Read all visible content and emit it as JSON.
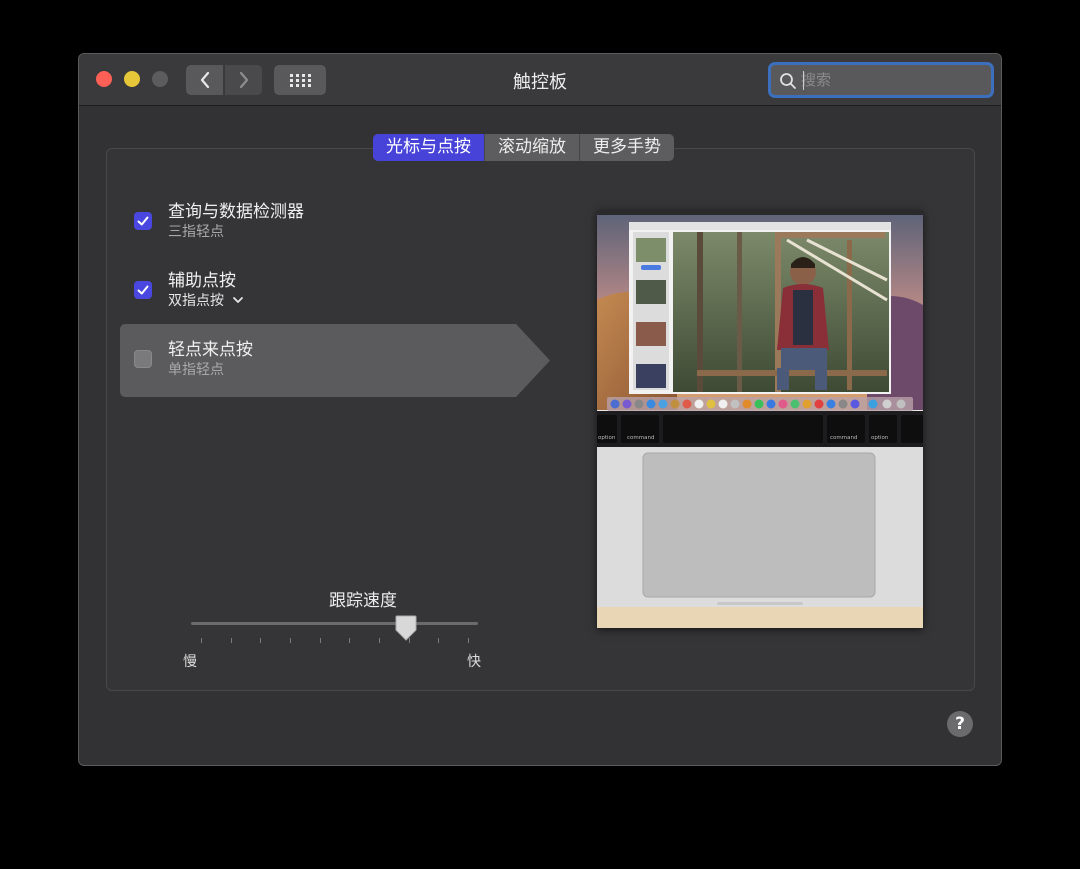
{
  "window": {
    "title": "触控板"
  },
  "toolbar": {
    "back_icon": "chevron-left-icon",
    "forward_icon": "chevron-right-icon",
    "grid_icon": "grid-icon"
  },
  "search": {
    "placeholder": "搜索",
    "value": ""
  },
  "tabs": [
    {
      "label": "光标与点按",
      "active": true
    },
    {
      "label": "滚动缩放",
      "active": false
    },
    {
      "label": "更多手势",
      "active": false
    }
  ],
  "options": [
    {
      "title": "查询与数据检测器",
      "subtitle": "三指轻点",
      "checked": true
    },
    {
      "title": "辅助点按",
      "subtitle": "双指点按",
      "checked": true,
      "dropdown": true
    },
    {
      "title": "轻点来点按",
      "subtitle": "单指轻点",
      "checked": false,
      "highlighted": true
    }
  ],
  "tracking": {
    "label": "跟踪速度",
    "min_label": "慢",
    "max_label": "快",
    "ticks": 10,
    "value_fraction": 0.75
  },
  "preview": {
    "keys": [
      "option",
      "command",
      "command",
      "option"
    ]
  },
  "help": {
    "label": "?"
  },
  "colors": {
    "accent": "#4a47e0",
    "focus_ring": "#3c6fbd",
    "close": "#fe5f57",
    "minimize": "#e6c73a"
  }
}
